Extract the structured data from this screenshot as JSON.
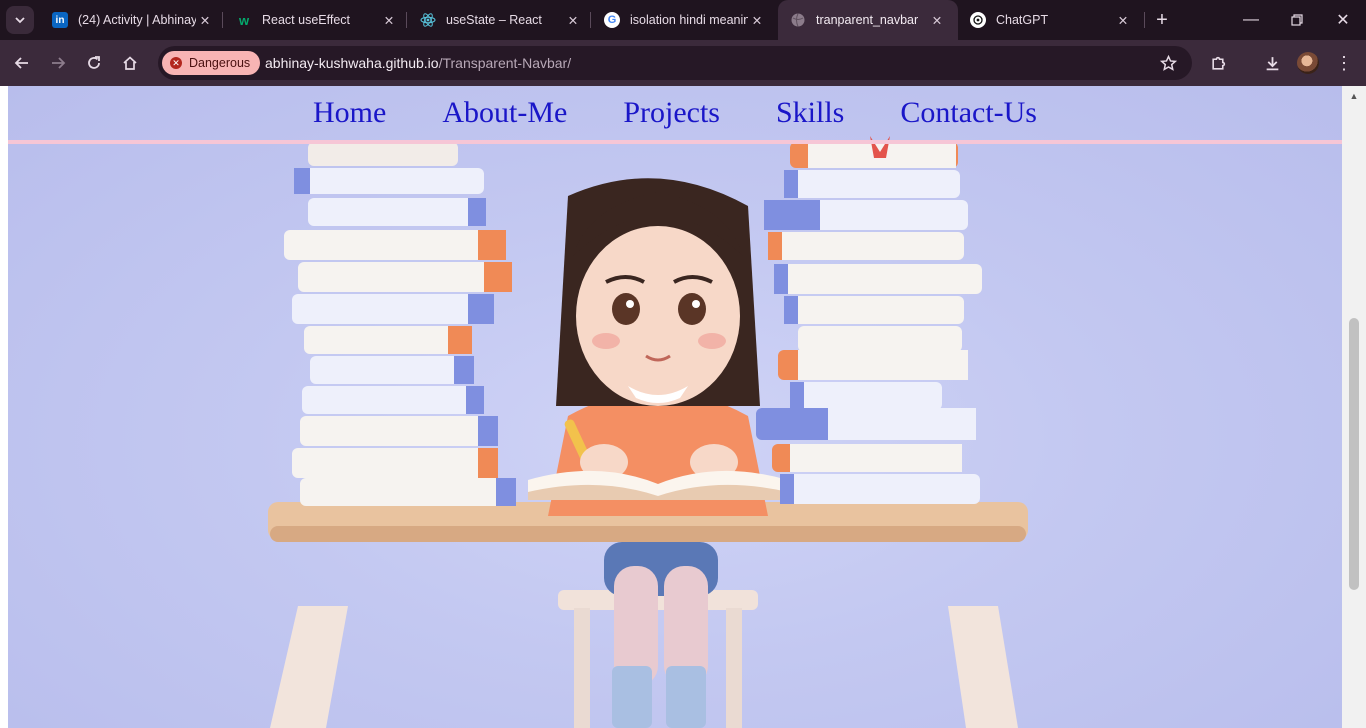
{
  "browser": {
    "tabs": [
      {
        "title": "(24) Activity | Abhinay",
        "favicon": "linkedin-icon",
        "active": false
      },
      {
        "title": "React useEffect",
        "favicon": "w3schools-icon",
        "active": false
      },
      {
        "title": "useState – React",
        "favicon": "react-icon",
        "active": false
      },
      {
        "title": "isolation hindi meaning",
        "favicon": "google-icon",
        "active": false
      },
      {
        "title": "tranparent_navbar",
        "favicon": "globe-icon",
        "active": true
      },
      {
        "title": "ChatGPT",
        "favicon": "chatgpt-icon",
        "active": false
      }
    ],
    "security_badge": "Dangerous",
    "url_host": "abhinay-kushwaha.github.io",
    "url_path": "/Transparent-Navbar/"
  },
  "page": {
    "nav": [
      "Home",
      "About-Me",
      "Projects",
      "Skills",
      "Contact-Us"
    ],
    "hero_image": "girl-reading-between-book-stacks"
  },
  "colors": {
    "nav_link": "#1a16c8",
    "nav_border": "#f6c6d6",
    "background": "#c3c8f1"
  }
}
